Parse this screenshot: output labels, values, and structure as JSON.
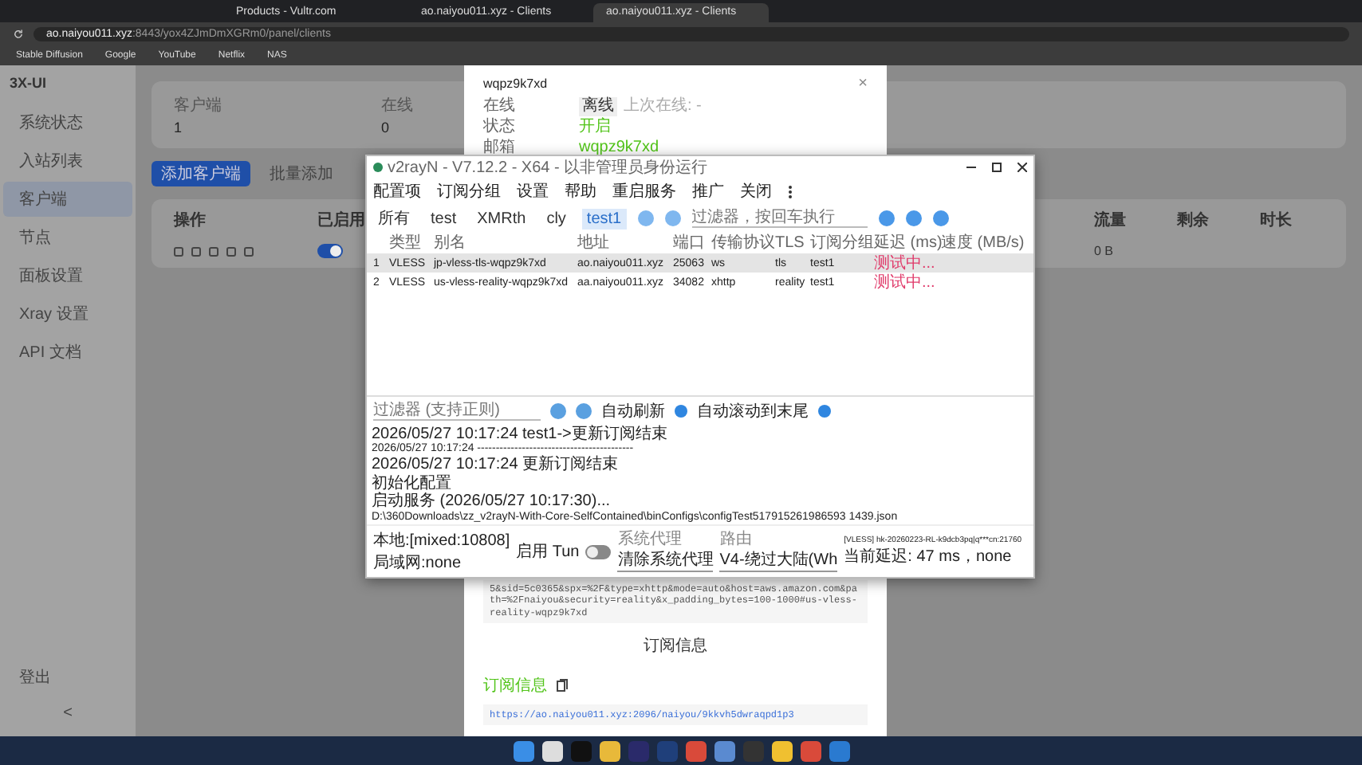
{
  "browser": {
    "tabs": [
      {
        "title": "Products - Vultr.com",
        "selected": false
      },
      {
        "title": "ao.naiyou011.xyz - Clients",
        "selected": false
      },
      {
        "title": "ao.naiyou011.xyz - Clients",
        "selected": true
      }
    ],
    "address": {
      "host": "ao.naiyou011.xyz",
      "path": ":8443/yox4ZJmDmXGRm0/panel/clients"
    },
    "bookmarks": [
      "Stable Diffusion",
      "Google",
      "YouTube",
      "Netflix",
      "NAS"
    ]
  },
  "sidebar": {
    "logo": "3X-UI",
    "items": [
      {
        "label": "系统状态",
        "selected": false
      },
      {
        "label": "入站列表",
        "selected": false
      },
      {
        "label": "客户端",
        "selected": true
      },
      {
        "label": "节点",
        "selected": false
      },
      {
        "label": "面板设置",
        "selected": false
      },
      {
        "label": "Xray 设置",
        "selected": false
      },
      {
        "label": "API 文档",
        "selected": false
      }
    ],
    "logout": "登出",
    "collapse": "<"
  },
  "main": {
    "stats": [
      {
        "label": "客户端",
        "value": "1"
      },
      {
        "label": "在线",
        "value": "0"
      }
    ],
    "buttons": [
      "添加客户端",
      "批量添加"
    ],
    "columns": [
      "操作",
      "已启用",
      "流量",
      "剩余",
      "时长"
    ],
    "rows": [
      {
        "enabled": true,
        "traffic": "0 B"
      }
    ]
  },
  "modal": {
    "title": "wqpz9k7xd",
    "close": "×",
    "fields": [
      {
        "label": "在线",
        "kind": "tag",
        "value": "离线",
        "extra": "上次在线: -"
      },
      {
        "label": "状态",
        "kind": "green",
        "value": "开启"
      },
      {
        "label": "邮箱",
        "kind": "green",
        "value": "wqpz9k7xd"
      }
    ],
    "link_text": "5&sid=5c0365&spx=%2F&type=xhttp&mode=auto&host=aws.amazon.com&path=%2Fnaiyou&security=reality&x_padding_bytes=100-1000#us-vless-reality-wqpz9k7xd",
    "sub_heading": "订阅信息",
    "sub_label": "订阅信息",
    "sub_url": "https://ao.naiyou011.xyz:2096/naiyou/9kkvh5dwraqpd1p3"
  },
  "v2rayn": {
    "title": "v2rayN - V7.12.2 - X64 - 以非管理员身份运行",
    "menu": [
      "配置项",
      "订阅分组",
      "设置",
      "帮助",
      "重启服务",
      "推广",
      "关闭"
    ],
    "groups": [
      {
        "label": "所有",
        "selected": false
      },
      {
        "label": "test",
        "selected": false
      },
      {
        "label": "XMRth",
        "selected": false
      },
      {
        "label": "cly",
        "selected": false
      },
      {
        "label": "test1",
        "selected": true
      }
    ],
    "filter_placeholder": "过滤器，按回车执行",
    "columns": [
      "类型",
      "别名",
      "地址",
      "端口",
      "传输协议",
      "TLS",
      "订阅分组",
      "延迟 (ms)",
      "速度 (MB/s)"
    ],
    "rows": [
      {
        "index": "1",
        "cells": [
          "VLESS",
          "jp-vless-tls-wqpz9k7xd",
          "ao.naiyou011.xyz",
          "25063",
          "ws",
          "tls",
          "test1",
          "测试中..."
        ],
        "selected": true
      },
      {
        "index": "2",
        "cells": [
          "VLESS",
          "us-vless-reality-wqpz9k7xd",
          "aa.naiyou011.xyz",
          "34082",
          "xhttp",
          "reality",
          "test1",
          "测试中..."
        ],
        "selected": false
      }
    ],
    "log_filter_placeholder": "过滤器 (支持正则)",
    "auto_refresh": {
      "label": "自动刷新",
      "on": true
    },
    "auto_scroll": {
      "label": "自动滚动到末尾",
      "on": true
    },
    "log": [
      "2026/05/27 10:17:24 test1->更新订阅结束",
      "2026/05/27 10:17:24 ------------------------------------------",
      "2026/05/27 10:17:24 更新订阅结束",
      "初始化配置",
      "启动服务 (2026/05/27 10:17:30)...",
      "D:\\360Downloads\\zz_v2rayN-With-Core-SelfContained\\binConfigs\\configTest517915261986593 1439.json"
    ],
    "status": {
      "local": "本地:[mixed:10808]",
      "lan": "局域网:none",
      "tun_label": "启用 Tun",
      "tun_on": false,
      "proxy_label": "系统代理",
      "proxy_value": "清除系统代理",
      "route_label": "路由",
      "route_value": "V4-绕过大陆(Wh",
      "server": "[VLESS] hk-20260223-RL-k9dcb3pq|q***cn:21760",
      "delay": "当前延迟: 47 ms，none"
    }
  }
}
